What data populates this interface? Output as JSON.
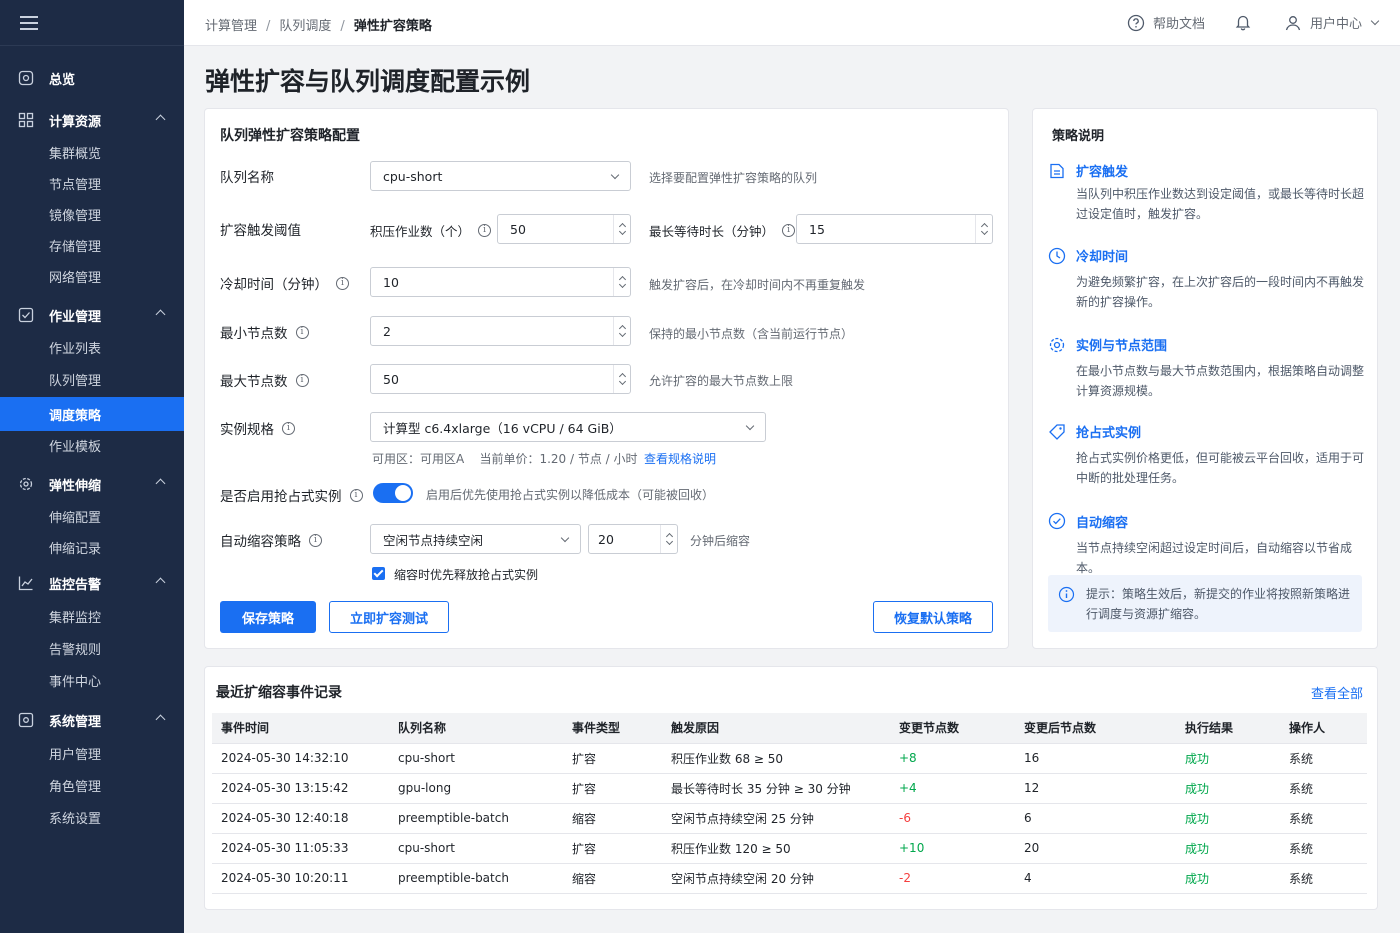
{
  "sidebar": {
    "groups": [
      {
        "label": "总览",
        "icon": "overview-icon",
        "children": []
      },
      {
        "label": "计算资源",
        "icon": "compute-resources-icon",
        "children": [
          "集群概览",
          "节点管理",
          "镜像管理",
          "存储管理",
          "网络管理"
        ]
      },
      {
        "label": "作业管理",
        "icon": "job-management-icon",
        "children": [
          "作业列表",
          "队列管理",
          "调度策略",
          "作业模板"
        ]
      },
      {
        "label": "弹性伸缩",
        "icon": "autoscaling-gear-icon",
        "children": [
          "伸缩配置",
          "伸缩记录"
        ]
      },
      {
        "label": "监控告警",
        "icon": "monitoring-chart-icon",
        "children": [
          "集群监控",
          "告警规则",
          "事件中心"
        ]
      },
      {
        "label": "系统管理",
        "icon": "system-management-icon",
        "children": [
          "用户管理",
          "角色管理",
          "系统设置"
        ]
      }
    ],
    "active_item": "调度策略"
  },
  "topbar": {
    "breadcrumb": [
      "计算管理",
      "队列调度",
      "弹性扩容策略"
    ],
    "help_label": "帮助文档",
    "user_label": "用户中心"
  },
  "page_title": "弹性扩容与队列调度配置示例",
  "config": {
    "title": "队列弹性扩容策略配置",
    "queue_name": {
      "label": "队列名称",
      "value": "cpu-short",
      "hint": "选择要配置弹性扩容策略的队列"
    },
    "trigger": {
      "label": "扩容触发阈值",
      "backlog_label": "积压作业数（个）",
      "backlog_value": "50",
      "wait_label": "最长等待时长（分钟）",
      "wait_value": "15"
    },
    "cooldown": {
      "label": "冷却时间（分钟）",
      "value": "10",
      "hint": "触发扩容后，在冷却时间内不再重复触发"
    },
    "min_nodes": {
      "label": "最小节点数",
      "value": "2",
      "hint": "保持的最小节点数（含当前运行节点）"
    },
    "max_nodes": {
      "label": "最大节点数",
      "value": "50",
      "hint": "允许扩容的最大节点数上限"
    },
    "instance_spec": {
      "label": "实例规格",
      "value": "计算型 c6.4xlarge（16 vCPU / 64 GiB）",
      "zone_info": "可用区：可用区A    当前单价：1.20 / 节点 / 小时",
      "link": "查看规格说明"
    },
    "preemptible": {
      "label": "是否启用抢占式实例",
      "enabled": true,
      "hint": "启用后优先使用抢占式实例以降低成本（可能被回收）"
    },
    "scale_in": {
      "label": "自动缩容策略",
      "mode": "空闲节点持续空闲",
      "minutes": "20",
      "suffix": "分钟后缩容",
      "checkbox_label": "缩容时优先释放抢占式实例",
      "checkbox_checked": true
    },
    "buttons": {
      "save": "保存策略",
      "test": "立即扩容测试",
      "reset": "恢复默认策略"
    }
  },
  "explain": {
    "title": "策略说明",
    "items": [
      {
        "icon": "trigger-document-icon",
        "title": "扩容触发",
        "text": "当队列中积压作业数达到设定阈值，或最长等待时长超过设定值时，触发扩容。"
      },
      {
        "icon": "clock-icon",
        "title": "冷却时间",
        "text": "为避免频繁扩容，在上次扩容后的一段时间内不再触发新的扩容操作。"
      },
      {
        "icon": "gear-icon",
        "title": "实例与节点范围",
        "text": "在最小节点数与最大节点数范围内，根据策略自动调整计算资源规模。"
      },
      {
        "icon": "tag-icon",
        "title": "抢占式实例",
        "text": "抢占式实例价格更低，但可能被云平台回收，适用于可中断的批处理任务。"
      },
      {
        "icon": "check-circle-icon",
        "title": "自动缩容",
        "text": "当节点持续空闲超过设定时间后，自动缩容以节省成本。"
      }
    ],
    "tip": "提示：策略生效后，新提交的作业将按照新策略进行调度与资源扩缩容。"
  },
  "events": {
    "title": "最近扩缩容事件记录",
    "view_all": "查看全部",
    "columns": [
      "事件时间",
      "队列名称",
      "事件类型",
      "触发原因",
      "变更节点数",
      "变更后节点数",
      "执行结果",
      "操作人"
    ],
    "rows": [
      [
        "2024-05-30 14:32:10",
        "cpu-short",
        "扩容",
        "积压作业数 68 ≥ 50",
        "+8",
        "16",
        "成功",
        "系统"
      ],
      [
        "2024-05-30 13:15:42",
        "gpu-long",
        "扩容",
        "最长等待时长 35 分钟 ≥ 30 分钟",
        "+4",
        "12",
        "成功",
        "系统"
      ],
      [
        "2024-05-30 12:40:18",
        "preemptible-batch",
        "缩容",
        "空闲节点持续空闲 25 分钟",
        "-6",
        "6",
        "成功",
        "系统"
      ],
      [
        "2024-05-30 11:05:33",
        "cpu-short",
        "扩容",
        "积压作业数 120 ≥ 50",
        "+10",
        "20",
        "成功",
        "系统"
      ],
      [
        "2024-05-30 10:20:11",
        "preemptible-batch",
        "缩容",
        "空闲节点持续空闲 20 分钟",
        "-2",
        "4",
        "成功",
        "系统"
      ]
    ]
  },
  "colors": {
    "primary": "#1a6ff2",
    "sidebar_bg": "#1d2b45",
    "success": "#00a74c",
    "danger": "#f53f3f"
  }
}
